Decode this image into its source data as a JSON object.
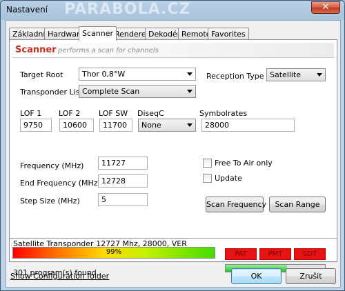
{
  "window": {
    "title": "Nastavení",
    "watermark": "PARABOLA.CZ",
    "close_symbol": "✕"
  },
  "tabs": [
    "Základní",
    "Hardware",
    "Scanner",
    "Renderer",
    "Dekodér",
    "Remote",
    "Favorites"
  ],
  "active_tab": "Scanner",
  "header": {
    "title": "Scanner",
    "subtitle": "performs a scan for channels"
  },
  "target_root": {
    "label": "Target Root",
    "value": "Thor 0,8°W"
  },
  "reception_type": {
    "label": "Reception Type",
    "value": "Satellite"
  },
  "transponder_list": {
    "label": "Transponder List",
    "value": "Complete Scan"
  },
  "lnb": {
    "lof1": {
      "label": "LOF 1",
      "value": "9750"
    },
    "lof2": {
      "label": "LOF 2",
      "value": "10600"
    },
    "lofsw": {
      "label": "LOF SW",
      "value": "11700"
    },
    "diseqc": {
      "label": "DiseqC",
      "value": "None"
    },
    "symbolrates": {
      "label": "Symbolrates",
      "value": "28000"
    }
  },
  "frequency": {
    "label": "Frequency (MHz)",
    "value": "11727"
  },
  "end_frequency": {
    "label": "End  Frequency (MHz)",
    "value": "12728"
  },
  "step_size": {
    "label": "Step Size (MHz)",
    "value": "5"
  },
  "free_to_air": {
    "label": "Free To Air only",
    "checked": false
  },
  "update": {
    "label": "Update",
    "checked": false
  },
  "buttons": {
    "scan_frequency": "Scan Frequency",
    "scan_range": "Scan Range",
    "ok": "OK",
    "cancel": "Zrušit"
  },
  "status": {
    "transponder": "Satellite Transponder 12727 Mhz, 28000, VER",
    "signal_label": "99%",
    "signal_level": 0.99,
    "found": "301 program(s) found..",
    "quality_level": 0.62
  },
  "badges": [
    "PAT",
    "PMT",
    "SDT"
  ],
  "config_link": "Show Configuration folder",
  "colors": {
    "header_title": "#c62e1e",
    "badge": "#e81414",
    "quality": "#27c027"
  }
}
